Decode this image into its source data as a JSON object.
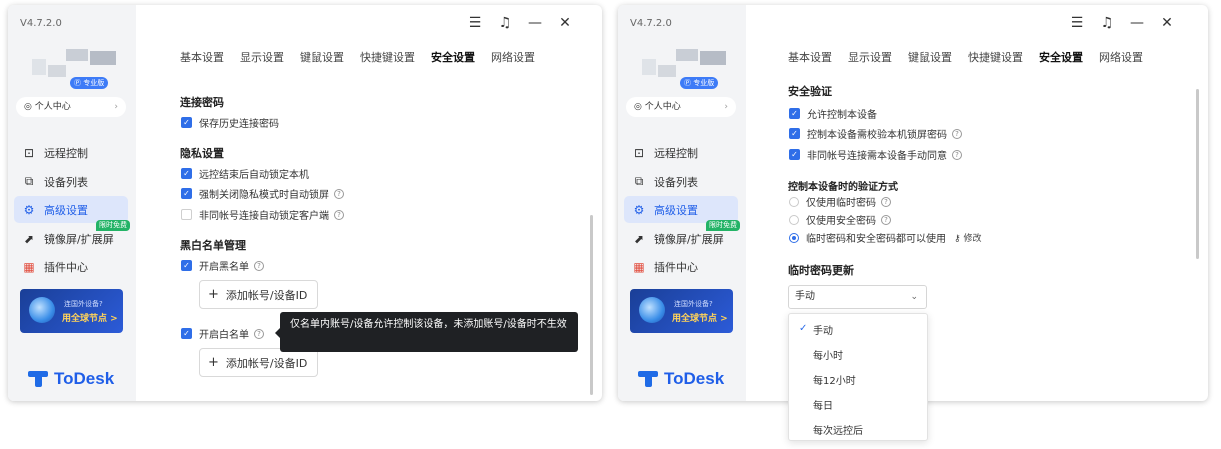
{
  "app": {
    "version": "V4.7.2.0",
    "pro_badge": "专业版",
    "personal_center": "个人中心",
    "nav": [
      "远程控制",
      "设备列表",
      "高级设置",
      "镜像屏/扩展屏",
      "插件中心"
    ],
    "nav_active_index": 2,
    "limited_free_tag": "限时免费",
    "promo_line1": "连国外设备?",
    "promo_line2": "用全球节点 >",
    "logo_text": "ToDesk",
    "brand_color": "#1f5ee8",
    "controls": [
      "menu-icon",
      "bell-icon",
      "minimize-icon",
      "close-icon"
    ]
  },
  "tabs": [
    "基本设置",
    "显示设置",
    "键鼠设置",
    "快捷键设置",
    "安全设置",
    "网络设置"
  ],
  "selected_tab": "安全设置",
  "left_window": {
    "connection_password": {
      "title": "连接密码",
      "save_history": "保存历史连接密码"
    },
    "privacy": {
      "title": "隐私设置",
      "auto_lock_after_remote": "远控结束后自动锁定本机",
      "force_lock_on_privacy_close": "强制关闭隐私模式时自动锁屏",
      "lock_client_diff_account": "非同帐号连接自动锁定客户端"
    },
    "blackwhite": {
      "title": "黑白名单管理",
      "enable_blacklist": "开启黑名单",
      "add_button": "添加帐号/设备ID",
      "enable_whitelist": "开启白名单",
      "tooltip": "仅名单内账号/设备允许控制该设备，未添加账号/设备时不生效"
    }
  },
  "right_window": {
    "security_verify": {
      "title": "安全验证",
      "allow_control": "允许控制本设备",
      "require_lock_password": "控制本设备需校验本机锁屏密码",
      "manual_consent": "非同帐号连接需本设备手动同意"
    },
    "verify_method": {
      "title": "控制本设备时的验证方式",
      "temp_only": "仅使用临时密码",
      "secure_only": "仅使用安全密码",
      "both": "临时密码和安全密码都可以使用",
      "edit": "修改"
    },
    "temp_update": {
      "title": "临时密码更新",
      "selected": "手动",
      "options": [
        "手动",
        "每小时",
        "每12小时",
        "每日",
        "每次远控后"
      ]
    }
  }
}
